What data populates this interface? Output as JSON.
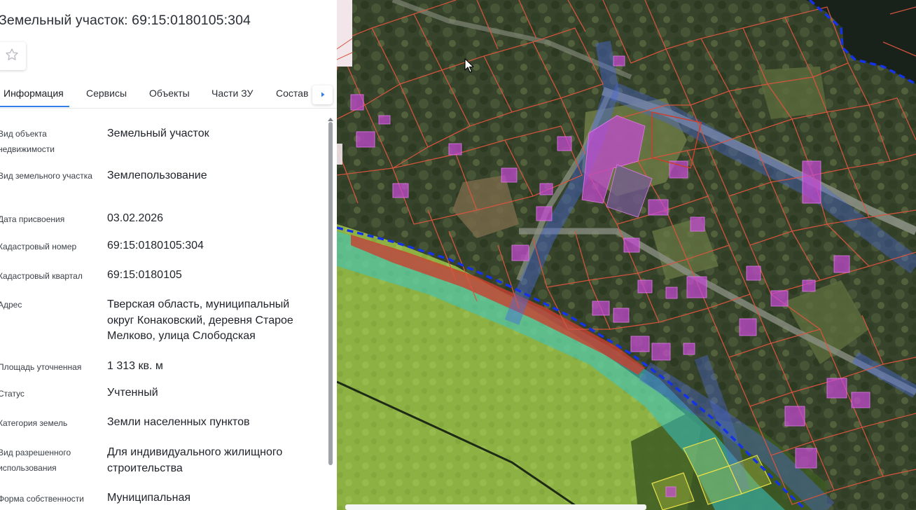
{
  "panel": {
    "title": "Земельный участок: 69:15:0180105:304",
    "favorite_icon": "star-outline-icon",
    "tabs": [
      {
        "label": "Информация",
        "active": true
      },
      {
        "label": "Сервисы",
        "active": false
      },
      {
        "label": "Объекты",
        "active": false
      },
      {
        "label": "Части ЗУ",
        "active": false
      },
      {
        "label": "Состав",
        "active": false
      }
    ],
    "tabs_next_icon": "caret-right-icon",
    "rows": [
      {
        "label": "Вид объекта недвижимости",
        "value": "Земельный участок"
      },
      {
        "label": "Вид земельного участка",
        "value": "Землепользование"
      },
      {
        "label": "Дата присвоения",
        "value": "03.02.2026"
      },
      {
        "label": "Кадастровый номер",
        "value": "69:15:0180105:304"
      },
      {
        "label": "Кадастровый квартал",
        "value": "69:15:0180105"
      },
      {
        "label": "Адрес",
        "value": "Тверская область, муниципальный округ Конаковский, деревня Старое Мелково, улица Слободская"
      },
      {
        "label": "Площадь уточненная",
        "value": "1 313 кв. м"
      },
      {
        "label": "Статус",
        "value": "Учтенный"
      },
      {
        "label": "Категория земель",
        "value": "Земли населенных пунктов"
      },
      {
        "label": "Вид разрешенного использования",
        "value": "Для индивидуального жилищного строительства"
      },
      {
        "label": "Форма собственности",
        "value": "Муниципальная"
      }
    ]
  },
  "map": {
    "layer": "satellite-imagery",
    "colors": {
      "parcel_border": "#d9553f",
      "building_fill": "#c64ad6",
      "zone_cyan": "#35c8c8",
      "zone_blue": "#4c68d6",
      "boundary_dash": "#1433e6",
      "field_green": "#8fb545"
    }
  }
}
